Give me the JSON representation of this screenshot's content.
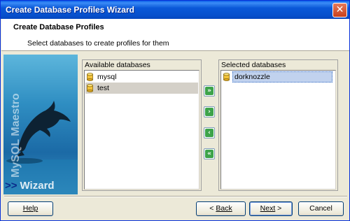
{
  "window": {
    "title": "Create Database Profiles Wizard",
    "close_glyph": "✕"
  },
  "header": {
    "title": "Create Database Profiles",
    "subtitle": "Select databases to create profiles for them"
  },
  "sidebar_art": {
    "brand": "MySQL Maestro",
    "arrows": ">>",
    "wizard": "Wizard"
  },
  "available": {
    "label": "Available databases",
    "items": [
      {
        "name": "mysql"
      },
      {
        "name": "test"
      }
    ]
  },
  "selected": {
    "label": "Selected databases",
    "items": [
      {
        "name": "dorknozzle"
      }
    ]
  },
  "move_buttons": {
    "add_all": "»",
    "add_one": "›",
    "remove_one": "‹",
    "remove_all": "«"
  },
  "footer": {
    "help_label": "Help",
    "back_prefix": "< ",
    "back_label": "Back",
    "next_label": "Next",
    "next_suffix": " >",
    "cancel_label": "Cancel"
  },
  "colors": {
    "titlebar": "#0a58d8",
    "selected_item": "#c1d2ee",
    "move_button": "#3da34a"
  }
}
